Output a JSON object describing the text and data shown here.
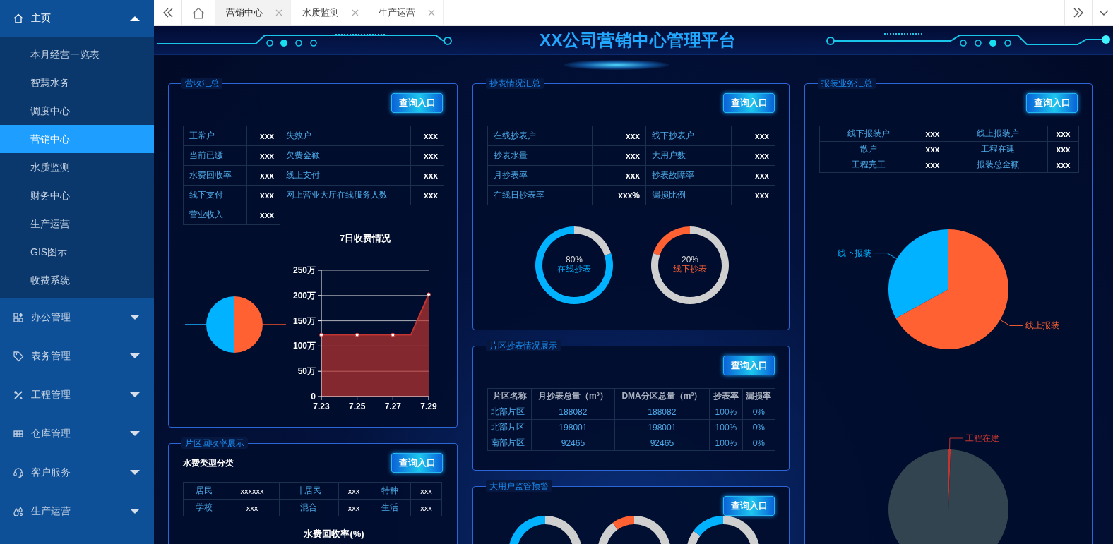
{
  "sidebar": {
    "items": [
      {
        "label": "主页",
        "expanded": true,
        "children": [
          {
            "label": "本月经营一览表",
            "selected": false
          },
          {
            "label": "智慧水务",
            "selected": false
          },
          {
            "label": "调度中心",
            "selected": false
          },
          {
            "label": "营销中心",
            "selected": true
          },
          {
            "label": "水质监测",
            "selected": false
          },
          {
            "label": "财务中心",
            "selected": false
          },
          {
            "label": "生产运营",
            "selected": false
          },
          {
            "label": "GIS图示",
            "selected": false
          },
          {
            "label": "收费系统",
            "selected": false
          }
        ]
      },
      {
        "label": "办公管理",
        "expanded": false
      },
      {
        "label": "表务管理",
        "expanded": false
      },
      {
        "label": "工程管理",
        "expanded": false
      },
      {
        "label": "仓库管理",
        "expanded": false
      },
      {
        "label": "客户服务",
        "expanded": false
      },
      {
        "label": "生产运营",
        "expanded": false
      }
    ]
  },
  "tabbar": {
    "tabs": [
      {
        "label": "营销中心",
        "selected": true
      },
      {
        "label": "水质监测",
        "selected": false
      },
      {
        "label": "生产运营",
        "selected": false
      }
    ]
  },
  "header": {
    "title": "XX公司营销中心管理平台"
  },
  "revenue_summary": {
    "title": "营收汇总",
    "button": "查询入口",
    "stats": [
      {
        "label": "正常户",
        "value": "xxx"
      },
      {
        "label": "失效户",
        "value": "xxx"
      },
      {
        "label": "当前已缴",
        "value": "xxx"
      },
      {
        "label": "欠费金额",
        "value": "xxx"
      },
      {
        "label": "水费回收率",
        "value": "xxx"
      },
      {
        "label": "线上支付",
        "value": "xxx"
      },
      {
        "label": "线下支付",
        "value": "xxx"
      },
      {
        "label": "网上营业大厅在线服务人数",
        "value": "xxx"
      },
      {
        "label": "营业收入",
        "value": "xxx"
      }
    ],
    "chart_data": {
      "type": "area",
      "title": "7日收费情况",
      "x": [
        7.23,
        7.24,
        7.25,
        7.26,
        7.27,
        7.28,
        7.29
      ],
      "series": [
        {
          "color": "#c23531",
          "values": [
            122,
            122,
            122,
            122,
            122,
            122,
            202
          ]
        }
      ],
      "ylim": [
        0,
        250
      ],
      "yticks": [
        {
          "value": 0,
          "label": "0"
        },
        {
          "value": 50,
          "label": "50万"
        },
        {
          "value": 100,
          "label": "100万"
        },
        {
          "value": 150,
          "label": "150万"
        },
        {
          "value": 200,
          "label": "200万"
        },
        {
          "value": 250,
          "label": "250万"
        }
      ],
      "xlim": [
        7.23,
        7.29
      ],
      "xticks": [
        7.23,
        7.25,
        7.27,
        7.29
      ],
      "grid": true
    }
  },
  "district_recovery": {
    "title": "片区回收率展示",
    "button": "查询入口",
    "subtitle": "水费类型分类",
    "types": [
      {
        "label": "居民",
        "value": "xxxxxx"
      },
      {
        "label": "非居民",
        "value": "xxx"
      },
      {
        "label": "特种",
        "value": "xxx"
      },
      {
        "label": "学校",
        "value": "xxx"
      },
      {
        "label": "混合",
        "value": "xxx"
      },
      {
        "label": "生活",
        "value": "xxx"
      }
    ],
    "chart_title": "水费回收率(%)"
  },
  "reading_summary": {
    "title": "抄表情况汇总",
    "button": "查询入口",
    "stats": [
      {
        "label": "在线抄表户",
        "value": "xxx"
      },
      {
        "label": "线下抄表户",
        "value": "xxx"
      },
      {
        "label": "抄表水量",
        "value": "xxx"
      },
      {
        "label": "大用户数",
        "value": "xxx"
      },
      {
        "label": "月抄表率",
        "value": "xxx"
      },
      {
        "label": "抄表故障率",
        "value": "xxx"
      },
      {
        "label": "在线日抄表率",
        "value": "xxx%"
      },
      {
        "label": "漏损比例",
        "value": "xxx"
      }
    ],
    "gauges": [
      {
        "color": "#00b2ff",
        "chart_data": {
          "type": "donut",
          "series": [
            {
              "name": "在线抄表",
              "values": [
                80,
                20
              ]
            }
          ],
          "value_labels": [
            "80%"
          ]
        }
      },
      {
        "color": "#ff6133",
        "chart_data": {
          "type": "donut",
          "series": [
            {
              "name": "线下抄表",
              "values": [
                20,
                80
              ]
            }
          ],
          "value_labels": [
            "20%"
          ]
        }
      }
    ]
  },
  "district_reading": {
    "title": "片区抄表情况展示",
    "button": "查询入口",
    "table": {
      "columns": [
        "片区名称",
        "月抄表总量（m³）",
        "DMA分区总量（m³）",
        "抄表率",
        "漏损率"
      ],
      "rows": [
        [
          "北部片区",
          "188082",
          "188082",
          "100%",
          "0%"
        ],
        [
          "北部片区",
          "198001",
          "198001",
          "100%",
          "0%"
        ],
        [
          "南部片区",
          "92465",
          "92465",
          "100%",
          "0%"
        ]
      ]
    }
  },
  "major_users": {
    "title": "大用户监管预警",
    "button": "查询入口",
    "gauges": [
      {
        "color": "#00b2ff"
      },
      {
        "color": "#ff6133"
      },
      {
        "color": "#00b2ff"
      }
    ]
  },
  "installation": {
    "title": "报装业务汇总",
    "button": "查询入口",
    "stats": [
      {
        "label": "线下报装户",
        "value": "xxx"
      },
      {
        "label": "线上报装户",
        "value": "xxx"
      },
      {
        "label": "散户",
        "value": "xxx"
      },
      {
        "label": "工程在建",
        "value": "xxx"
      },
      {
        "label": "工程完工",
        "value": "xxx"
      },
      {
        "label": "报装总金额",
        "value": "xxx"
      }
    ],
    "pies": [
      {
        "slices": [
          {
            "label": "线下报装",
            "color": "#00b2ff"
          },
          {
            "label": "线上报装",
            "color": "#ff6133"
          }
        ]
      },
      {
        "slices": [
          {
            "label": "工程在建",
            "color": "#c23531"
          },
          {
            "color": "#32444f"
          }
        ]
      }
    ]
  }
}
